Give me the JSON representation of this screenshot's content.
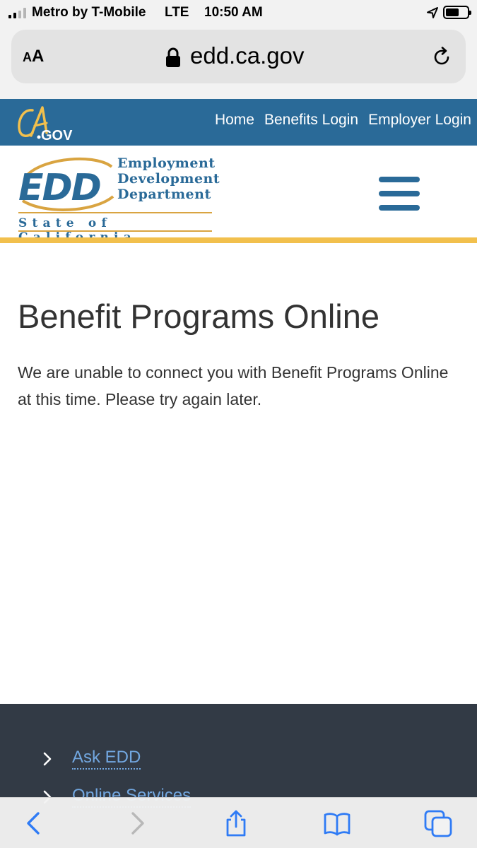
{
  "status_bar": {
    "carrier": "Metro by T-Mobile",
    "network": "LTE",
    "time": "10:50 AM",
    "location_icon": "location-arrow-icon",
    "battery_icon": "battery-icon"
  },
  "browser": {
    "text_size_label_big": "A",
    "text_size_label_small": "A",
    "url": "edd.ca.gov",
    "lock_icon": "lock-icon",
    "reload_icon": "reload-icon"
  },
  "ca_header": {
    "logo_text": "CA.GOV",
    "nav": [
      "Home",
      "Benefits Login",
      "Employer Login"
    ],
    "bg_color": "#2a6a98"
  },
  "edd_header": {
    "logo_mark": "EDD",
    "logo_lines": [
      "Employment",
      "Development",
      "Department"
    ],
    "state_line": "State of California",
    "menu_icon": "hamburger-menu-icon",
    "accent_color": "#f2c04d"
  },
  "main": {
    "title": "Benefit Programs Online",
    "message": "We are unable to connect you with Benefit Programs Online at this time. Please try again later."
  },
  "footer": {
    "links": [
      "Ask EDD",
      "Online Services"
    ],
    "bg_color": "#323a45",
    "link_color": "#72a7e0"
  },
  "toolbar": {
    "icons": [
      "back-arrow-icon",
      "forward-arrow-icon",
      "share-icon",
      "bookmarks-icon",
      "tabs-icon"
    ],
    "accent_color": "#2f7bf5"
  }
}
